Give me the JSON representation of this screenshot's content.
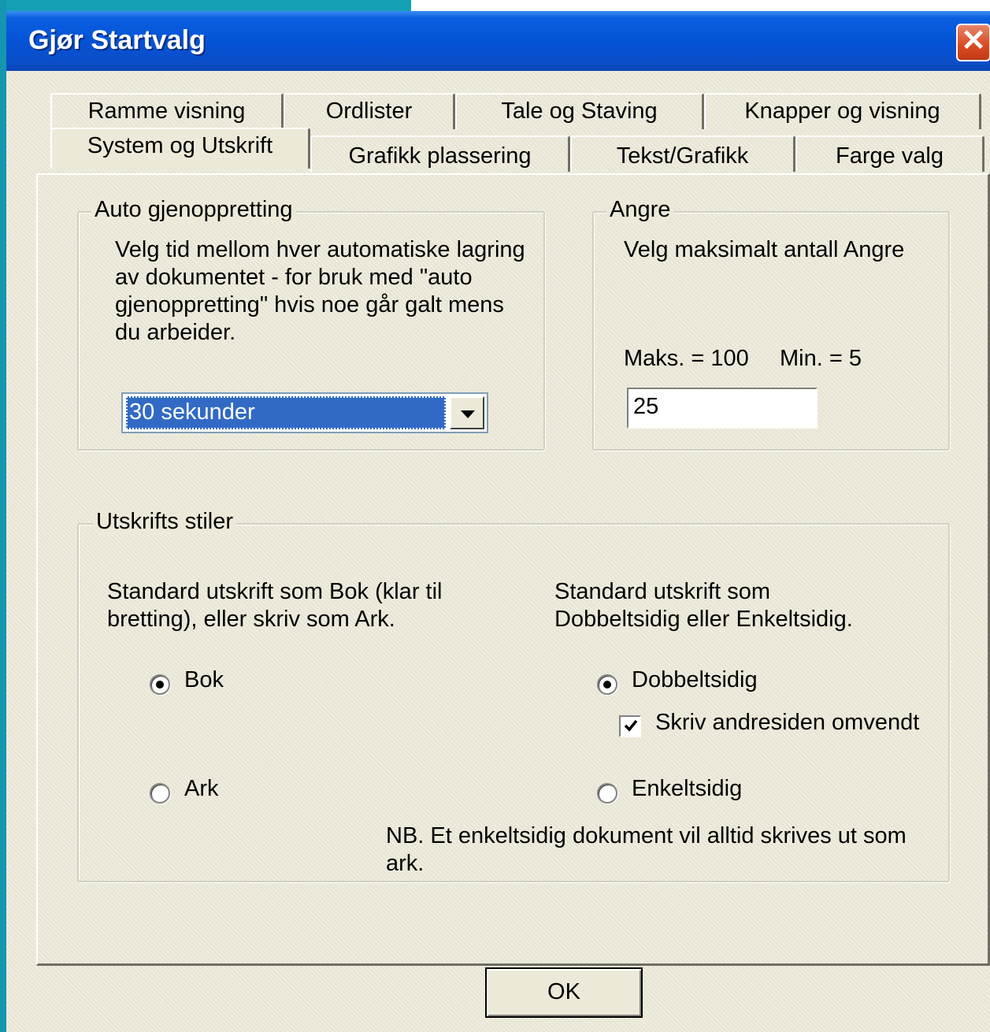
{
  "window": {
    "title": "Gjør Startvalg",
    "close_glyph": "✕"
  },
  "tabs": {
    "row1": [
      "Ramme visning",
      "Ordlister",
      "Tale og Staving",
      "Knapper og visning"
    ],
    "row2": [
      "System og Utskrift",
      "Grafikk plassering",
      "Tekst/Grafikk",
      "Farge valg"
    ],
    "selected": "System og Utskrift"
  },
  "auto_recovery": {
    "title": "Auto gjenoppretting",
    "description": [
      "Velg tid mellom hver automatiske lagring",
      "av dokumentet - for bruk med \"auto",
      "gjenoppretting\" hvis noe går galt mens",
      "du arbeider."
    ],
    "interval_value": "30 sekunder"
  },
  "undo": {
    "title": "Angre",
    "description": "Velg maksimalt antall Angre",
    "max_label": "Maks. = 100",
    "min_label": "Min. = 5",
    "value": "25"
  },
  "print_styles": {
    "title": "Utskrifts stiler",
    "left_description": [
      "Standard utskrift som Bok (klar til",
      "bretting), eller skriv som Ark."
    ],
    "right_description": [
      "Standard utskrift som",
      "Dobbeltsidig eller Enkeltsidig."
    ],
    "option_book": "Bok",
    "option_sheet": "Ark",
    "option_duplex": "Dobbeltsidig",
    "option_reverse": "Skriv andresiden omvendt",
    "option_simplex": "Enkeltsidig",
    "note": "NB. Et enkeltsidig dokument vil alltid skrives ut som ark."
  },
  "buttons": {
    "ok": "OK"
  },
  "colors": {
    "titlebar": "#0553d6",
    "dialog_bg": "#ece9d8",
    "selection": "#316ac5",
    "close": "#d94a22"
  }
}
